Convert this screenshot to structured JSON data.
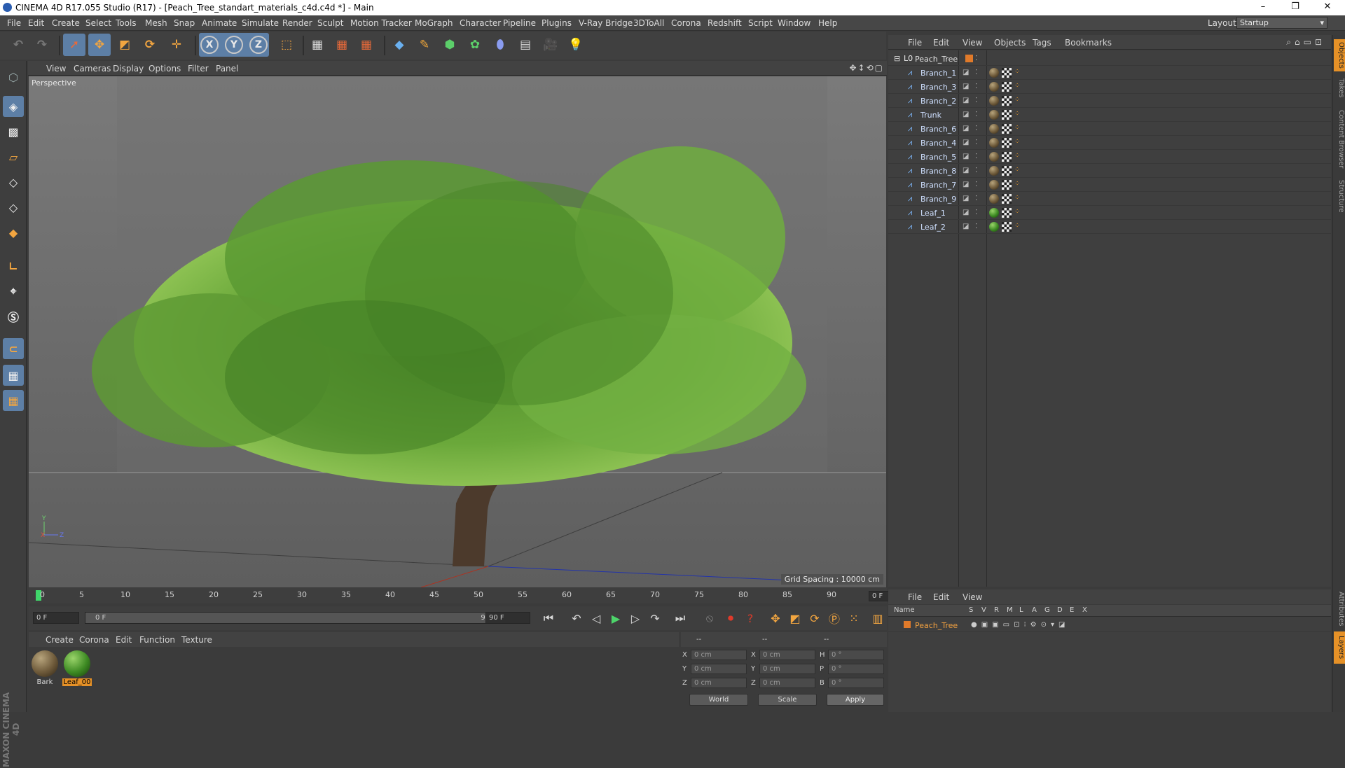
{
  "window": {
    "title": "CINEMA 4D R17.055 Studio (R17) - [Peach_Tree_standart_materials_c4d.c4d *] - Main",
    "controls": [
      "–",
      "❐",
      "✕"
    ]
  },
  "menubar": {
    "items": [
      "File",
      "Edit",
      "Create",
      "Select",
      "Tools",
      "Mesh",
      "Snap",
      "Animate",
      "Simulate",
      "Render",
      "Sculpt",
      "Motion Tracker",
      "MoGraph",
      "Character",
      "Pipeline",
      "Plugins",
      "V-Ray Bridge",
      "3DToAll",
      "Corona",
      "Redshift",
      "Script",
      "Window",
      "Help"
    ],
    "layout_label": "Layout:",
    "layout_value": "Startup"
  },
  "toolbar": {
    "axis_x": "X",
    "axis_y": "Y",
    "axis_z": "Z"
  },
  "viewport": {
    "menu": [
      "View",
      "Cameras",
      "Display",
      "Options",
      "Filter",
      "Panel"
    ],
    "label": "Perspective",
    "grid_spacing": "Grid Spacing : 10000 cm",
    "nav_icons": "✥↕⟲▢"
  },
  "timeline": {
    "ticks": [
      "0",
      "5",
      "10",
      "15",
      "20",
      "25",
      "30",
      "35",
      "40",
      "45",
      "50",
      "55",
      "60",
      "65",
      "70",
      "75",
      "80",
      "85",
      "90"
    ],
    "current_frame": "0 F",
    "playhead_frame": 0
  },
  "transport": {
    "start_field": "0 F",
    "range_start": "0 F",
    "range_end": "90 F",
    "end_field": "90 F"
  },
  "material_manager": {
    "menu": [
      "Create",
      "Corona",
      "Edit",
      "Function",
      "Texture"
    ],
    "materials": [
      {
        "name": "Bark",
        "color": "#6e5a3a",
        "selected": false
      },
      {
        "name": "Leaf_00",
        "color": "#3d8a23",
        "selected": true
      }
    ]
  },
  "coordinates": {
    "header": [
      "--",
      "--",
      "--"
    ],
    "rows": [
      {
        "a": "X",
        "a_val": "0 cm",
        "b": "X",
        "b_val": "0 cm",
        "c": "H",
        "c_val": "0 °"
      },
      {
        "a": "Y",
        "a_val": "0 cm",
        "b": "Y",
        "b_val": "0 cm",
        "c": "P",
        "c_val": "0 °"
      },
      {
        "a": "Z",
        "a_val": "0 cm",
        "b": "Z",
        "b_val": "0 cm",
        "c": "B",
        "c_val": "0 °"
      }
    ],
    "space": "World",
    "mode": "Scale",
    "apply": "Apply"
  },
  "object_manager": {
    "menu": [
      "File",
      "Edit",
      "View",
      "Objects",
      "Tags",
      "Bookmarks"
    ],
    "root": "Peach_Tree",
    "objects": [
      {
        "name": "Branch_1",
        "mat": "bark"
      },
      {
        "name": "Branch_3",
        "mat": "bark"
      },
      {
        "name": "Branch_2",
        "mat": "bark"
      },
      {
        "name": "Trunk",
        "mat": "bark"
      },
      {
        "name": "Branch_6",
        "mat": "bark"
      },
      {
        "name": "Branch_4",
        "mat": "bark"
      },
      {
        "name": "Branch_5",
        "mat": "bark"
      },
      {
        "name": "Branch_8",
        "mat": "bark"
      },
      {
        "name": "Branch_7",
        "mat": "bark"
      },
      {
        "name": "Branch_9",
        "mat": "bark"
      },
      {
        "name": "Leaf_1",
        "mat": "leaf"
      },
      {
        "name": "Leaf_2",
        "mat": "leaf"
      }
    ]
  },
  "layer_manager": {
    "menu": [
      "File",
      "Edit",
      "View"
    ],
    "columns": [
      "Name",
      "S",
      "V",
      "R",
      "M",
      "L",
      "A",
      "G",
      "D",
      "E",
      "X"
    ],
    "layers": [
      {
        "name": "Peach_Tree",
        "color": "#e07a2a"
      }
    ]
  },
  "side_tabs": {
    "top": [
      "Objects",
      "Takes",
      "Content Browser",
      "Structure"
    ],
    "bottom": [
      "Attributes",
      "Layers"
    ]
  },
  "branding": "MAXON CINEMA 4D",
  "colors": {
    "accent": "#e69127",
    "selected_tool": "#5d7fa6",
    "playhead": "#3fd66a",
    "layer": "#e07a2a"
  }
}
